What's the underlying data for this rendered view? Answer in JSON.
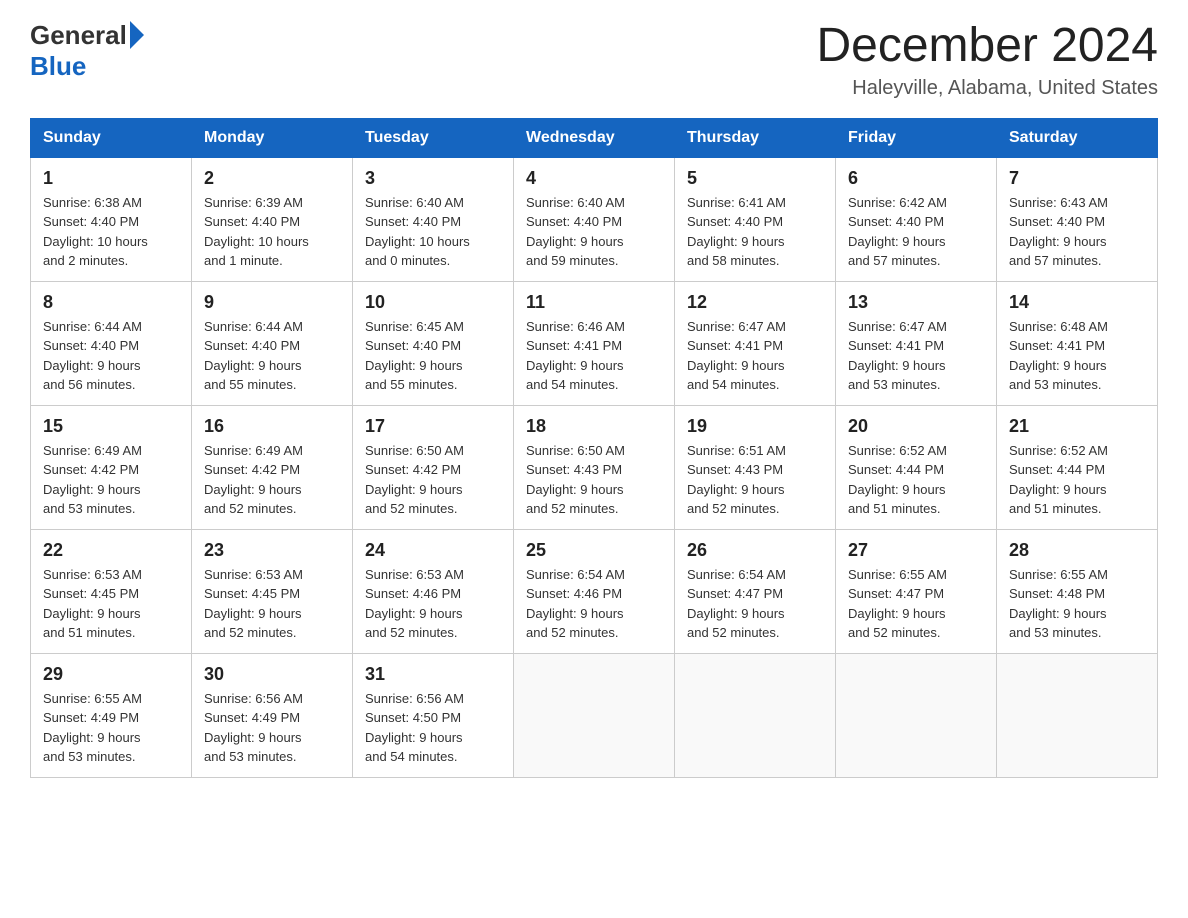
{
  "header": {
    "logo_general": "General",
    "logo_blue": "Blue",
    "title": "December 2024",
    "subtitle": "Haleyville, Alabama, United States"
  },
  "calendar": {
    "days_of_week": [
      "Sunday",
      "Monday",
      "Tuesday",
      "Wednesday",
      "Thursday",
      "Friday",
      "Saturday"
    ],
    "weeks": [
      [
        {
          "day": "1",
          "sunrise": "6:38 AM",
          "sunset": "4:40 PM",
          "daylight": "10 hours and 2 minutes."
        },
        {
          "day": "2",
          "sunrise": "6:39 AM",
          "sunset": "4:40 PM",
          "daylight": "10 hours and 1 minute."
        },
        {
          "day": "3",
          "sunrise": "6:40 AM",
          "sunset": "4:40 PM",
          "daylight": "10 hours and 0 minutes."
        },
        {
          "day": "4",
          "sunrise": "6:40 AM",
          "sunset": "4:40 PM",
          "daylight": "9 hours and 59 minutes."
        },
        {
          "day": "5",
          "sunrise": "6:41 AM",
          "sunset": "4:40 PM",
          "daylight": "9 hours and 58 minutes."
        },
        {
          "day": "6",
          "sunrise": "6:42 AM",
          "sunset": "4:40 PM",
          "daylight": "9 hours and 57 minutes."
        },
        {
          "day": "7",
          "sunrise": "6:43 AM",
          "sunset": "4:40 PM",
          "daylight": "9 hours and 57 minutes."
        }
      ],
      [
        {
          "day": "8",
          "sunrise": "6:44 AM",
          "sunset": "4:40 PM",
          "daylight": "9 hours and 56 minutes."
        },
        {
          "day": "9",
          "sunrise": "6:44 AM",
          "sunset": "4:40 PM",
          "daylight": "9 hours and 55 minutes."
        },
        {
          "day": "10",
          "sunrise": "6:45 AM",
          "sunset": "4:40 PM",
          "daylight": "9 hours and 55 minutes."
        },
        {
          "day": "11",
          "sunrise": "6:46 AM",
          "sunset": "4:41 PM",
          "daylight": "9 hours and 54 minutes."
        },
        {
          "day": "12",
          "sunrise": "6:47 AM",
          "sunset": "4:41 PM",
          "daylight": "9 hours and 54 minutes."
        },
        {
          "day": "13",
          "sunrise": "6:47 AM",
          "sunset": "4:41 PM",
          "daylight": "9 hours and 53 minutes."
        },
        {
          "day": "14",
          "sunrise": "6:48 AM",
          "sunset": "4:41 PM",
          "daylight": "9 hours and 53 minutes."
        }
      ],
      [
        {
          "day": "15",
          "sunrise": "6:49 AM",
          "sunset": "4:42 PM",
          "daylight": "9 hours and 53 minutes."
        },
        {
          "day": "16",
          "sunrise": "6:49 AM",
          "sunset": "4:42 PM",
          "daylight": "9 hours and 52 minutes."
        },
        {
          "day": "17",
          "sunrise": "6:50 AM",
          "sunset": "4:42 PM",
          "daylight": "9 hours and 52 minutes."
        },
        {
          "day": "18",
          "sunrise": "6:50 AM",
          "sunset": "4:43 PM",
          "daylight": "9 hours and 52 minutes."
        },
        {
          "day": "19",
          "sunrise": "6:51 AM",
          "sunset": "4:43 PM",
          "daylight": "9 hours and 52 minutes."
        },
        {
          "day": "20",
          "sunrise": "6:52 AM",
          "sunset": "4:44 PM",
          "daylight": "9 hours and 51 minutes."
        },
        {
          "day": "21",
          "sunrise": "6:52 AM",
          "sunset": "4:44 PM",
          "daylight": "9 hours and 51 minutes."
        }
      ],
      [
        {
          "day": "22",
          "sunrise": "6:53 AM",
          "sunset": "4:45 PM",
          "daylight": "9 hours and 51 minutes."
        },
        {
          "day": "23",
          "sunrise": "6:53 AM",
          "sunset": "4:45 PM",
          "daylight": "9 hours and 52 minutes."
        },
        {
          "day": "24",
          "sunrise": "6:53 AM",
          "sunset": "4:46 PM",
          "daylight": "9 hours and 52 minutes."
        },
        {
          "day": "25",
          "sunrise": "6:54 AM",
          "sunset": "4:46 PM",
          "daylight": "9 hours and 52 minutes."
        },
        {
          "day": "26",
          "sunrise": "6:54 AM",
          "sunset": "4:47 PM",
          "daylight": "9 hours and 52 minutes."
        },
        {
          "day": "27",
          "sunrise": "6:55 AM",
          "sunset": "4:47 PM",
          "daylight": "9 hours and 52 minutes."
        },
        {
          "day": "28",
          "sunrise": "6:55 AM",
          "sunset": "4:48 PM",
          "daylight": "9 hours and 53 minutes."
        }
      ],
      [
        {
          "day": "29",
          "sunrise": "6:55 AM",
          "sunset": "4:49 PM",
          "daylight": "9 hours and 53 minutes."
        },
        {
          "day": "30",
          "sunrise": "6:56 AM",
          "sunset": "4:49 PM",
          "daylight": "9 hours and 53 minutes."
        },
        {
          "day": "31",
          "sunrise": "6:56 AM",
          "sunset": "4:50 PM",
          "daylight": "9 hours and 54 minutes."
        },
        null,
        null,
        null,
        null
      ]
    ],
    "labels": {
      "sunrise": "Sunrise:",
      "sunset": "Sunset:",
      "daylight": "Daylight:"
    }
  }
}
